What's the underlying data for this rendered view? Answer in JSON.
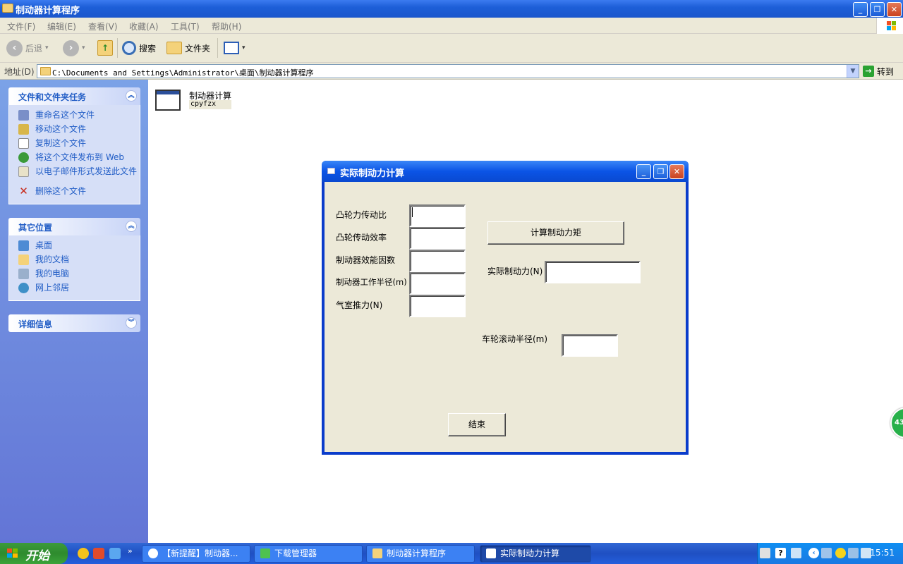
{
  "window": {
    "title": "制动器计算程序",
    "controls": {
      "minimize": "_",
      "maximize": "❐",
      "close": "✕"
    }
  },
  "menu": [
    "文件(F)",
    "编辑(E)",
    "查看(V)",
    "收藏(A)",
    "工具(T)",
    "帮助(H)"
  ],
  "toolbar": {
    "back": "后退",
    "search": "搜索",
    "folders": "文件夹"
  },
  "address": {
    "label": "地址(D)",
    "path": "C:\\Documents and Settings\\Administrator\\桌面\\制动器计算程序",
    "go": "转到"
  },
  "taskpane": {
    "panel1": {
      "title": "文件和文件夹任务",
      "items": [
        "重命名这个文件",
        "移动这个文件",
        "复制这个文件",
        "将这个文件发布到 Web",
        "以电子邮件形式发送此文件",
        "删除这个文件"
      ]
    },
    "panel2": {
      "title": "其它位置",
      "items": [
        "桌面",
        "我的文档",
        "我的电脑",
        "网上邻居"
      ]
    },
    "panel3": {
      "title": "详细信息"
    }
  },
  "file": {
    "name": "制动器计算",
    "sub": "cpyfzx"
  },
  "dialog": {
    "title": "实际制动力计算",
    "labels": {
      "cam_ratio": "凸轮力传动比",
      "cam_eff": "凸轮传动效率",
      "brake_factor": "制动器效能因数",
      "brake_radius": "制动器工作半径(m)",
      "chamber_force": "气室推力(N)",
      "actual_force": "实际制动力(N)",
      "wheel_radius": "车轮滚动半径(m)"
    },
    "values": {
      "cam_ratio": "",
      "cam_eff": "",
      "brake_factor": "",
      "brake_radius": "",
      "chamber_force": "",
      "actual_force": "",
      "wheel_radius": ""
    },
    "buttons": {
      "calc": "计算制动力矩",
      "end": "结束"
    }
  },
  "badge": "43",
  "taskbar": {
    "start": "开始",
    "tasks": [
      "【新提醒】制动器...",
      "下载管理器",
      "制动器计算程序",
      "实际制动力计算"
    ],
    "clock": "15:51"
  }
}
